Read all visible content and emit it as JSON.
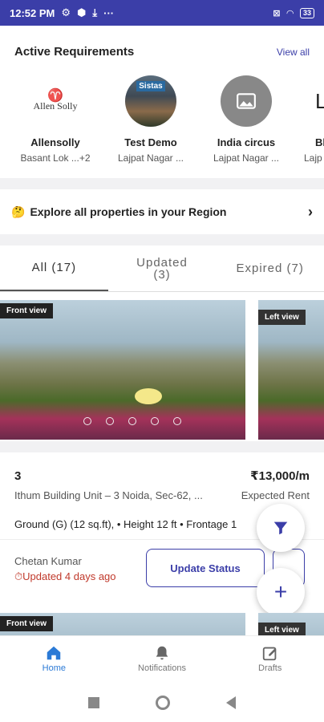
{
  "status_bar": {
    "time": "12:52 PM",
    "battery": "33"
  },
  "requirements": {
    "title": "Active Requirements",
    "view_all": "View all",
    "items": [
      {
        "name": "Allensolly",
        "location": "Basant Lok ...+2",
        "logo_text": "Allen Solly"
      },
      {
        "name": "Test Demo",
        "location": "Lajpat Nagar ...",
        "logo_text": "Sistas"
      },
      {
        "name": "India circus",
        "location": "Lajpat Nagar ..."
      },
      {
        "name": "Bl",
        "location": "Lajp",
        "logo_text": "L"
      }
    ]
  },
  "explore": {
    "emoji": "🤔",
    "label": "Explore all properties in your Region"
  },
  "tabs": [
    {
      "label": "All (17)"
    },
    {
      "label": "Updated",
      "sub": "(3)"
    },
    {
      "label": "Expired (7)"
    }
  ],
  "property": {
    "photo_label_1": "Front view",
    "photo_label_2": "Left view",
    "unit": "3",
    "price": "₹13,000/m",
    "address": "Ithum Building Unit – 3 Noida, Sec-62, ...",
    "price_label": "Expected Rent",
    "specs": "Ground (G) (12 sq.ft), • Height 12 ft • Frontage 1",
    "owner": "Chetan Kumar",
    "updated": "Updated 4 days ago",
    "update_button": "Update Status"
  },
  "next_card": {
    "photo_label_1": "Front view",
    "photo_label_2": "Left view"
  },
  "bottom_nav": [
    {
      "label": "Home"
    },
    {
      "label": "Notifications"
    },
    {
      "label": "Drafts"
    }
  ],
  "colors": {
    "accent": "#3b3ea8",
    "active_tab": "#2b7ad6",
    "updated": "#c0392b"
  }
}
